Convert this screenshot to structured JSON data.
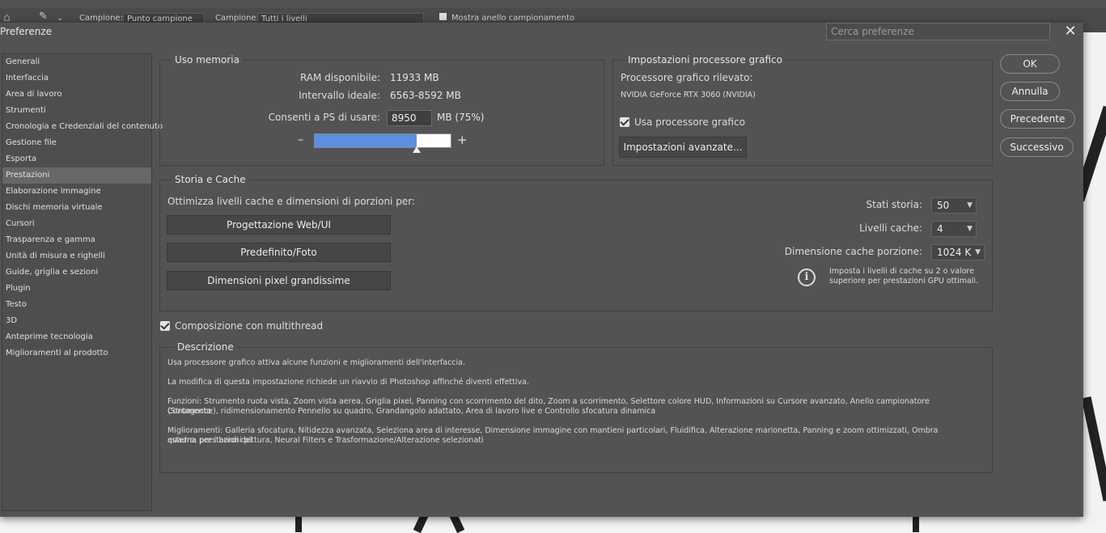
{
  "background": {
    "options_bar": {
      "sample_label_1": "Campione:",
      "sample_value_1": "Punto campione",
      "sample_label_2": "Campione:",
      "sample_value_2": "Tutti i livelli",
      "show_ring_label": "Mostra anello campionamento"
    }
  },
  "dialog": {
    "title": "Preferenze",
    "search_placeholder": "Cerca preferenze",
    "close_glyph": "✕"
  },
  "sidebar": {
    "items": [
      {
        "label": "Generali"
      },
      {
        "label": "Interfaccia"
      },
      {
        "label": "Area di lavoro"
      },
      {
        "label": "Strumenti"
      },
      {
        "label": "Cronologia e Credenziali del contenuto"
      },
      {
        "label": "Gestione file"
      },
      {
        "label": "Esporta"
      },
      {
        "label": "Prestazioni"
      },
      {
        "label": "Elaborazione immagine"
      },
      {
        "label": "Dischi memoria virtuale"
      },
      {
        "label": "Cursori"
      },
      {
        "label": "Trasparenza e gamma"
      },
      {
        "label": "Unità di misura e righelli"
      },
      {
        "label": "Guide, griglia e sezioni"
      },
      {
        "label": "Plugin"
      },
      {
        "label": "Testo"
      },
      {
        "label": "3D"
      },
      {
        "label": "Anteprime tecnologia"
      },
      {
        "label": "Miglioramenti al prodotto"
      }
    ],
    "active_index": 7
  },
  "memory": {
    "legend": "Uso memoria",
    "ram_label": "RAM disponibile:",
    "ram_value": "11933 MB",
    "range_label": "Intervallo ideale:",
    "range_value": "6563-8592 MB",
    "allow_label": "Consenti a PS di usare:",
    "allow_value": "8950",
    "allow_unit": "MB (75%)",
    "minus": "–",
    "plus": "+",
    "slider_fraction": 0.75
  },
  "gpu": {
    "legend": "Impostazioni processore grafico",
    "detected_label": "Processore grafico rilevato:",
    "detected_value": "NVIDIA GeForce RTX 3060 (NVIDIA)",
    "use_gpu_label": "Usa processore grafico",
    "use_gpu_checked": true,
    "advanced_button": "Impostazioni avanzate..."
  },
  "history": {
    "legend": "Storia e Cache",
    "optimize_label": "Ottimizza livelli cache e dimensioni di porzioni per:",
    "btn_web": "Progettazione Web/UI",
    "btn_default": "Predefinito/Foto",
    "btn_huge": "Dimensioni pixel grandissime",
    "states_label": "Stati storia:",
    "states_value": "50",
    "levels_label": "Livelli cache:",
    "levels_value": "4",
    "tile_label": "Dimensione cache porzione:",
    "tile_value": "1024 K",
    "info_text_1": "Imposta i livelli di cache su 2 o valore",
    "info_text_2": "superiore per prestazioni GPU ottimali."
  },
  "multithread": {
    "label": "Composizione con multithread",
    "checked": true
  },
  "description": {
    "legend": "Descrizione",
    "p1": "Usa processore grafico attiva alcune funzioni e miglioramenti dell'interfaccia.",
    "p2": "La modifica di questa impostazione richiede un riavvio di Photoshop affinché diventi effettiva.",
    "p3a": "Funzioni: Strumento ruota vista, Zoom vista aerea, Griglia pixel, Panning con scorrimento del dito, Zoom a scorrimento, Selettore colore HUD, Informazioni su Cursore avanzato, Anello campionatore (Strumento",
    "p3b": "Contagocce), ridimensionamento Pennello su quadro, Grandangolo adattato, Area di lavoro live e Controllo sfocatura dinamica",
    "p4a": "Miglioramenti: Galleria sfocatura, Nitidezza avanzata, Seleziona area di interesse, Dimensione immagine con mantieni particolari, Fluidifica, Alterazione marionetta, Panning e zoom ottimizzati, Ombra esterna per i bordi del",
    "p4b": "quadro, prestazioni pittura, Neural Filters e Trasformazione/Alterazione selezionati"
  },
  "buttons": {
    "ok": "OK",
    "cancel": "Annulla",
    "prev": "Precedente",
    "next": "Successivo"
  },
  "colors": {
    "dialog_bg": "#535353",
    "slider_fill": "#5b8fe0"
  }
}
